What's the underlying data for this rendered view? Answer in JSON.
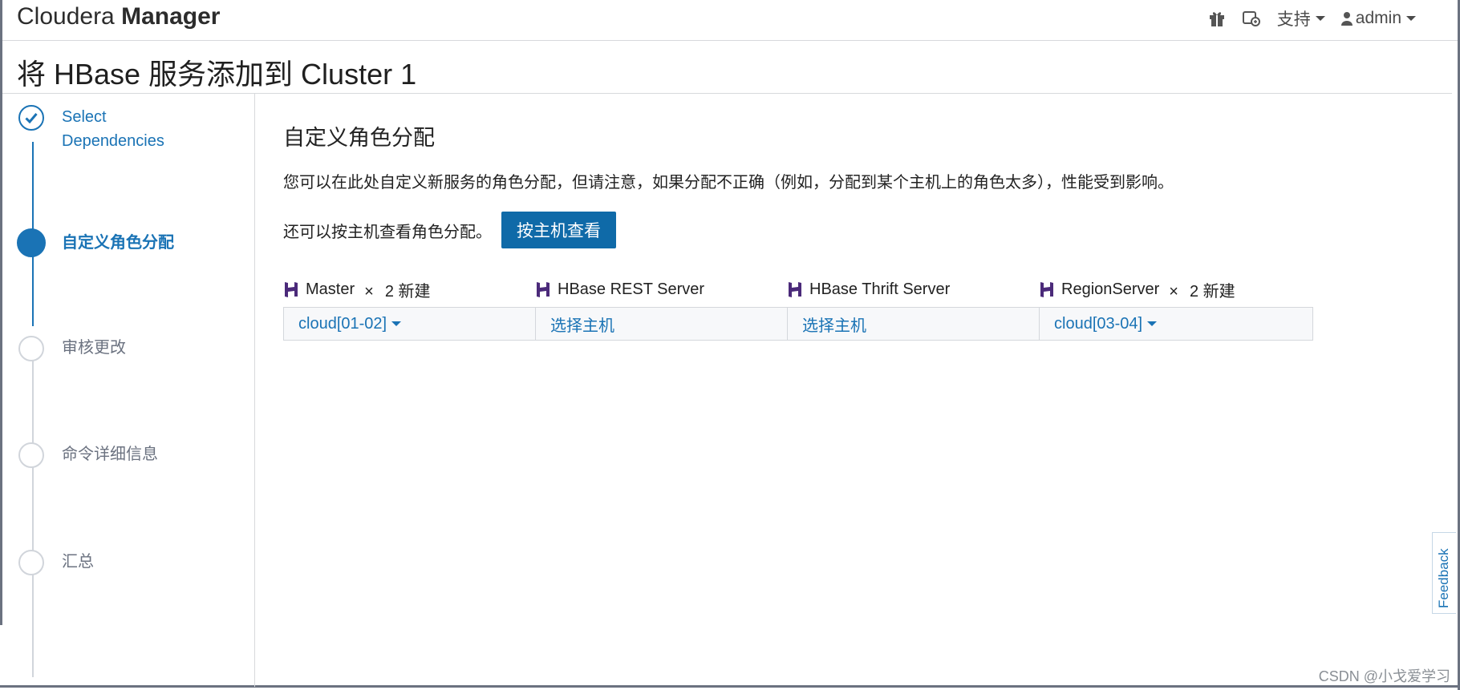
{
  "header": {
    "brand_light": "Cloudera",
    "brand_bold": "Manager",
    "gift_icon": "gift-icon",
    "support_icon": "support-tool-icon",
    "support_label": "支持",
    "user_label": "admin"
  },
  "page": {
    "title": "将 HBase 服务添加到 Cluster 1"
  },
  "steps": [
    {
      "label_line1": "Select",
      "label_line2": "Dependencies",
      "state": "done"
    },
    {
      "label": "自定义角色分配",
      "state": "active"
    },
    {
      "label": "审核更改",
      "state": "pending"
    },
    {
      "label": "命令详细信息",
      "state": "pending"
    },
    {
      "label": "汇总",
      "state": "pending"
    }
  ],
  "main": {
    "section_title": "自定义角色分配",
    "description": "您可以在此处自定义新服务的角色分配，但请注意，如果分配不正确（例如，分配到某个主机上的角色太多），性能受到影响。",
    "byhost_text": "还可以按主机查看角色分配。",
    "byhost_button": "按主机查看",
    "roles": [
      {
        "name": "Master",
        "times": "×",
        "count": "2 新建",
        "value": "cloud[01-02]",
        "has_dropdown": true
      },
      {
        "name": "HBase REST Server",
        "value": "选择主机",
        "has_dropdown": false
      },
      {
        "name": "HBase Thrift Server",
        "value": "选择主机",
        "has_dropdown": false
      },
      {
        "name": "RegionServer",
        "times": "×",
        "count": "2 新建",
        "value": "cloud[03-04]",
        "has_dropdown": true
      }
    ]
  },
  "feedback_label": "Feedback",
  "watermark": "CSDN @小戈爱学习",
  "colors": {
    "accent": "#1a73b5",
    "button": "#0f6aa8",
    "hbase_icon": "#4b2a7a"
  }
}
